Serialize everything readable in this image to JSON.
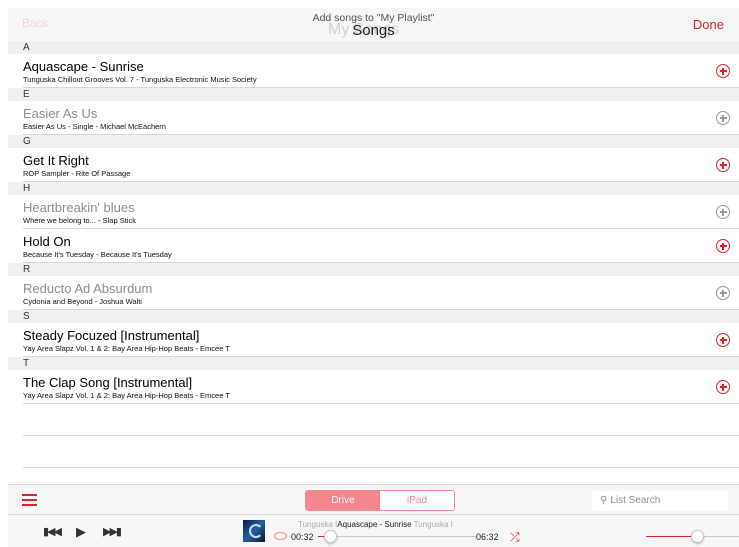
{
  "colors": {
    "accent": "#e0212c",
    "segment_active": "#f4868d"
  },
  "header": {
    "back_label": "Back",
    "ghost_title": "My Songs",
    "subtitle": "Add songs to \"My Playlist\"",
    "title": "Songs",
    "done_label": "Done"
  },
  "list": {
    "sections": [
      {
        "letter": "A",
        "songs": [
          {
            "title": "Aquascape - Sunrise",
            "subtitle": "Tunguska Chillout Grooves Vol. 7 - Tunguska Electronic Music Society",
            "available": true
          }
        ]
      },
      {
        "letter": "E",
        "songs": [
          {
            "title": "Easier As Us",
            "subtitle": "Easier As Us - Single - Michael McEachern",
            "available": false
          }
        ]
      },
      {
        "letter": "G",
        "songs": [
          {
            "title": "Get It Right",
            "subtitle": "ROP Sampler - Rite Of Passage",
            "available": true
          }
        ]
      },
      {
        "letter": "H",
        "songs": [
          {
            "title": "Heartbreakin' blues",
            "subtitle": "Where we belong to... - Slap Stick",
            "available": false
          },
          {
            "title": "Hold On",
            "subtitle": "Because It's Tuesday - Because It's Tuesday",
            "available": true
          }
        ]
      },
      {
        "letter": "R",
        "songs": [
          {
            "title": "Reducto Ad Absurdum",
            "subtitle": "Cydonia and Beyond - Joshua Walti",
            "available": false
          }
        ]
      },
      {
        "letter": "S",
        "songs": [
          {
            "title": "Steady Focuzed [Instrumental]",
            "subtitle": "Yay Area Slapz Vol. 1 & 2: Bay Area Hip-Hop Beats - Emcee T",
            "available": true
          }
        ]
      },
      {
        "letter": "T",
        "songs": [
          {
            "title": "The Clap Song [Instrumental]",
            "subtitle": "Yay Area Slapz Vol. 1 & 2: Bay Area Hip-Hop Beats - Emcee T",
            "available": true
          }
        ]
      }
    ]
  },
  "toolbar": {
    "menu_icon": "hamburger-icon",
    "segments": [
      {
        "label": "Drive",
        "active": true
      },
      {
        "label": "iPad",
        "active": false
      }
    ],
    "search_placeholder": "List Search",
    "search_icon": "magnifier-icon"
  },
  "player": {
    "prev_icon": "skip-back-icon",
    "play_icon": "play-icon",
    "next_icon": "skip-forward-icon",
    "now_playing_pre": "Tunguska I",
    "now_playing_title": "Aquascape - Sunrise",
    "now_playing_post": "Tunguska I",
    "elapsed": "00:32",
    "remaining": "06:32",
    "progress": 0.08,
    "volume": 0.55,
    "shuffle_icon": "shuffle-icon"
  }
}
